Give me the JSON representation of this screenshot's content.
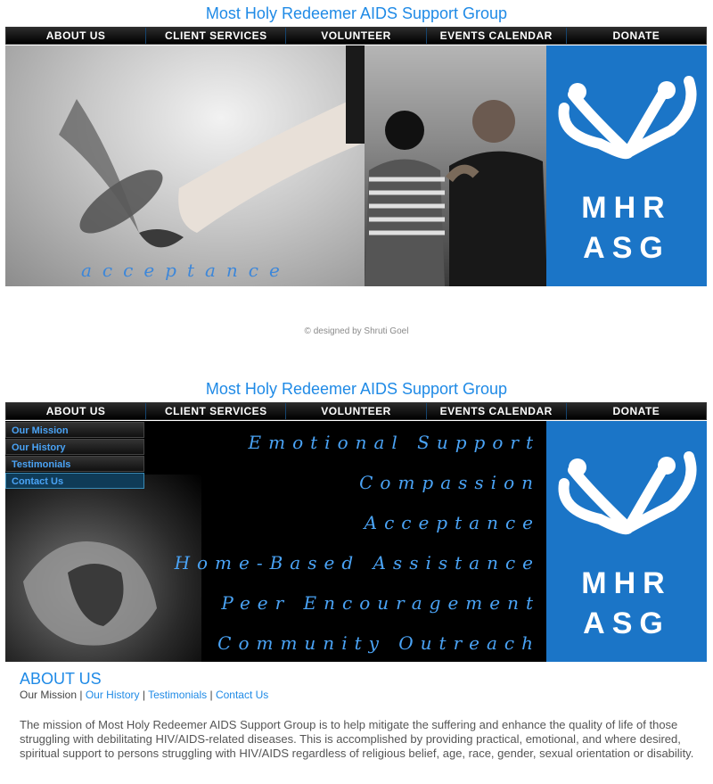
{
  "site": {
    "title": "Most Holy Redeemer AIDS Support Group"
  },
  "nav": {
    "items": [
      "ABOUT US",
      "CLIENT SERVICES",
      "VOLUNTEER",
      "EVENTS CALENDAR",
      "DONATE"
    ]
  },
  "logo": {
    "line1": "MHR",
    "line2": "ASG"
  },
  "banner_top": {
    "tagline": "acceptance"
  },
  "credit": "© designed by Shruti Goel",
  "submenu": {
    "items": [
      "Our Mission",
      "Our History",
      "Testimonials",
      "Contact Us"
    ],
    "active": "Contact Us"
  },
  "phrases": [
    "Emotional Support",
    "Compassion",
    "Acceptance",
    "Home-Based Assistance",
    "Peer Encouragement",
    "Community Outreach"
  ],
  "about": {
    "heading": "ABOUT US",
    "subnav": {
      "current": "Our Mission",
      "links": [
        "Our History",
        "Testimonials",
        "Contact Us"
      ],
      "separator": "|"
    },
    "mission_text": "The mission of Most Holy Redeemer AIDS Support Group is to help mitigate the suffering and enhance the quality of life of those struggling with debilitating HIV/AIDS-related diseases. This is accomplished by providing practical, emotional, and where desired, spiritual support to persons struggling with HIV/AIDS regardless of religious belief, age, race, gender, sexual orientation or disability."
  },
  "colors": {
    "accent": "#1f8ae6",
    "logo_blue": "#1b75c7",
    "phrase_blue": "#4aa3f5"
  }
}
